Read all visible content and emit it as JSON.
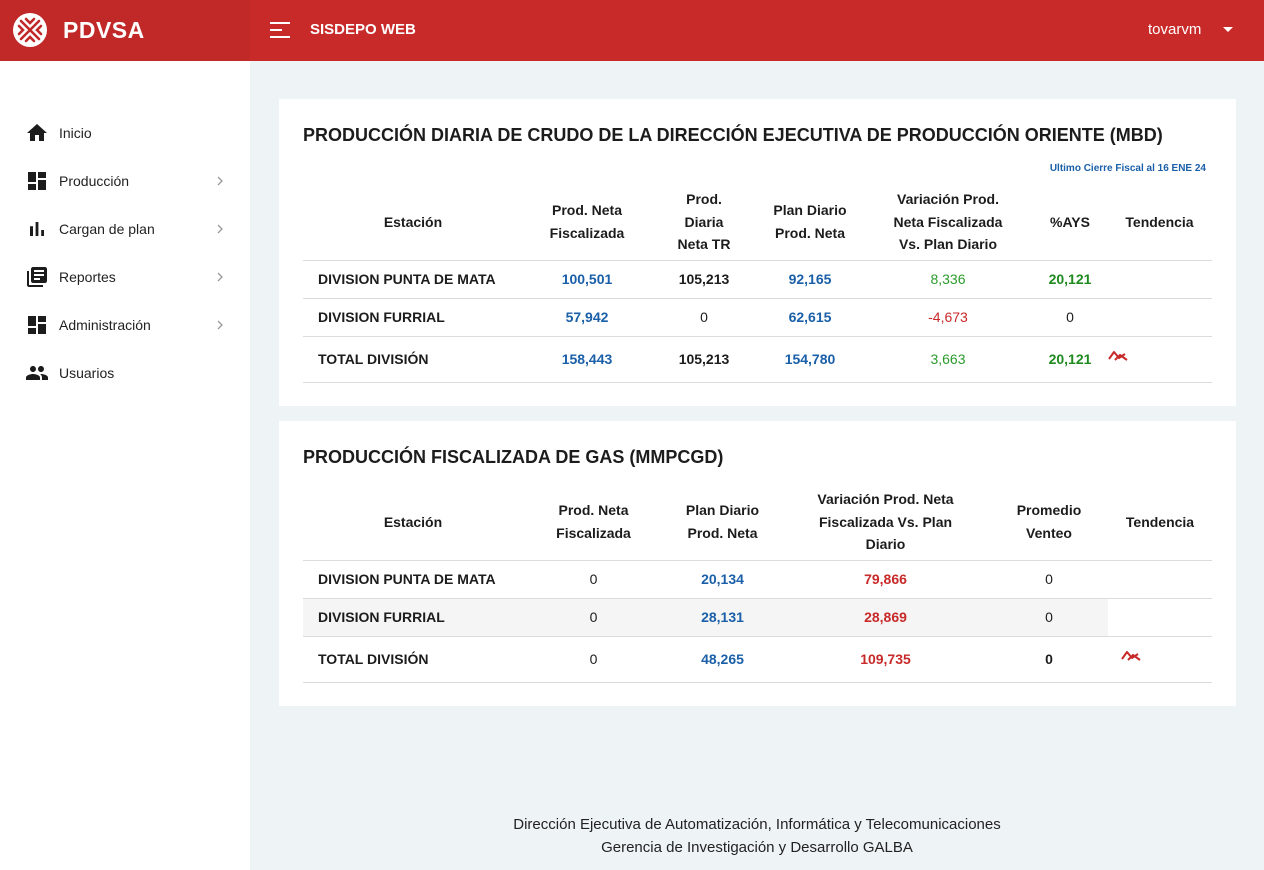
{
  "header": {
    "brand_name": "PDVSA",
    "app_title": "SISDEPO WEB",
    "user": "tovarvm",
    "colors": {
      "topbar": "#c82a2a",
      "brand_bg": "#c12828"
    }
  },
  "sidebar": {
    "items": [
      {
        "label": "Inicio",
        "icon": "home-icon",
        "has_submenu": false
      },
      {
        "label": "Producción",
        "icon": "dashboard-icon",
        "has_submenu": true
      },
      {
        "label": "Cargan de plan",
        "icon": "bar-chart-icon",
        "has_submenu": true
      },
      {
        "label": "Reportes",
        "icon": "library-books-icon",
        "has_submenu": true
      },
      {
        "label": "Administración",
        "icon": "dashboard-icon",
        "has_submenu": true
      },
      {
        "label": "Usuarios",
        "icon": "people-icon",
        "has_submenu": false
      }
    ]
  },
  "crudo": {
    "title": "PRODUCCIÓN DIARIA DE CRUDO DE LA DIRECCIÓN EJECUTIVA DE PRODUCCIÓN ORIENTE (MBD)",
    "fiscal_note": "Ultimo Cierre Fiscal al 16 ENE 24",
    "headers": [
      "Estación",
      "Prod. Neta Fiscalizada",
      "Prod. Diaria Neta TR",
      "Plan Diario Prod. Neta",
      "Variación Prod. Neta Fiscalizada Vs. Plan Diario",
      "%AYS",
      "Tendencia"
    ],
    "rows": [
      {
        "station": "DIVISION PUNTA DE MATA",
        "fiscalizada": "100,501",
        "neta_tr": "105,213",
        "plan": "92,165",
        "variacion": "8,336",
        "ays": "20,121"
      },
      {
        "station": "DIVISION FURRIAL",
        "fiscalizada": "57,942",
        "neta_tr": "0",
        "plan": "62,615",
        "variacion": "-4,673",
        "ays": "0"
      },
      {
        "station": "TOTAL DIVISIÓN",
        "fiscalizada": "158,443",
        "neta_tr": "105,213",
        "plan": "154,780",
        "variacion": "3,663",
        "ays": "20,121",
        "trend": "trending-down-icon"
      }
    ]
  },
  "gas": {
    "title": "PRODUCCIÓN FISCALIZADA DE GAS (MMPCGD)",
    "headers": [
      "Estación",
      "Prod. Neta Fiscalizada",
      "Plan Diario Prod. Neta",
      "Variación Prod. Neta Fiscalizada Vs. Plan Diario",
      "Promedio Venteo",
      "Tendencia"
    ],
    "rows": [
      {
        "station": "DIVISION PUNTA DE MATA",
        "fiscalizada": "0",
        "plan": "20,134",
        "variacion": "79,866",
        "venteo": "0"
      },
      {
        "station": "DIVISION FURRIAL",
        "fiscalizada": "0",
        "plan": "28,131",
        "variacion": "28,869",
        "venteo": "0"
      },
      {
        "station": "TOTAL DIVISIÓN",
        "fiscalizada": "0",
        "plan": "48,265",
        "variacion": "109,735",
        "venteo": "0",
        "trend": "trending-down-icon"
      }
    ]
  },
  "footer": {
    "line1": "Dirección Ejecutiva de Automatización, Informática y Telecomunicaciones",
    "line2": "Gerencia de Investigación y Desarrollo GALBA"
  }
}
